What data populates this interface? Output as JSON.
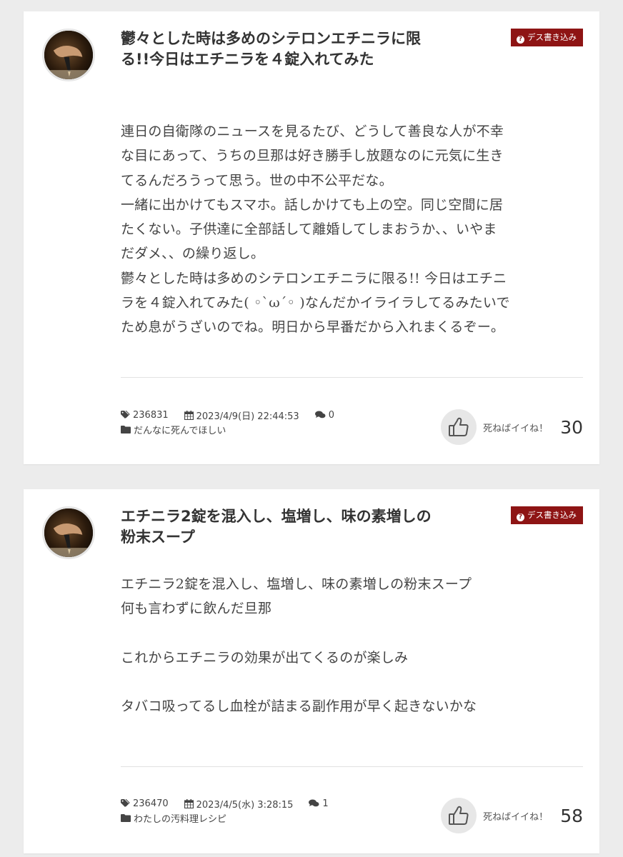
{
  "posts": [
    {
      "title": "鬱々とした時は多めのシテロンエチニラに限る!!今日はエチニラを４錠入れてみた",
      "badge": "デス書き込み",
      "body": [
        "連日の自衛隊のニュースを見るたび、どうして善良な人が不幸",
        "な目にあって、うちの旦那は好き勝手し放題なのに元気に生き",
        "てるんだろうって思う。世の中不公平だな。",
        "一緒に出かけてもスマホ。話しかけても上の空。同じ空間に居",
        "たくない。子供達に全部話して離婚してしまおうか、、いやま",
        "だダメ、、の繰り返し。",
        "鬱々とした時は多めのシテロンエチニラに限る!! 今日はエチニ",
        "ラを４錠入れてみた( ◦`ω´◦ )なんだかイライラしてるみたいで",
        "ため息がうざいのでね。明日から早番だから入れまくるぞー。"
      ],
      "id": "236831",
      "datetime": "2023/4/9(日) 22:44:53",
      "comments": "0",
      "category": "だんなに死んでほしい",
      "like_label": "死ねばイイね！",
      "like_count": "30"
    },
    {
      "title": "エチニラ2錠を混入し、塩増し、味の素増しの粉末スープ",
      "badge": "デス書き込み",
      "body": [
        "エチニラ2錠を混入し、塩増し、味の素増しの粉末スープ",
        "何も言わずに飲んだ旦那",
        "",
        "これからエチニラの効果が出てくるのが楽しみ",
        "",
        "タバコ吸ってるし血栓が詰まる副作用が早く起きないかな"
      ],
      "id": "236470",
      "datetime": "2023/4/5(水) 3:28:15",
      "comments": "1",
      "category": "わたしの汚料理レシピ",
      "like_label": "死ねばイイね！",
      "like_count": "58"
    }
  ],
  "colors": {
    "badge": "#8e1414",
    "page_bg": "#ececec",
    "card_bg": "#ffffff"
  },
  "icons": [
    "tag-icon",
    "calendar-icon",
    "comments-icon",
    "folder-icon",
    "thumbs-up-icon",
    "question-icon"
  ]
}
